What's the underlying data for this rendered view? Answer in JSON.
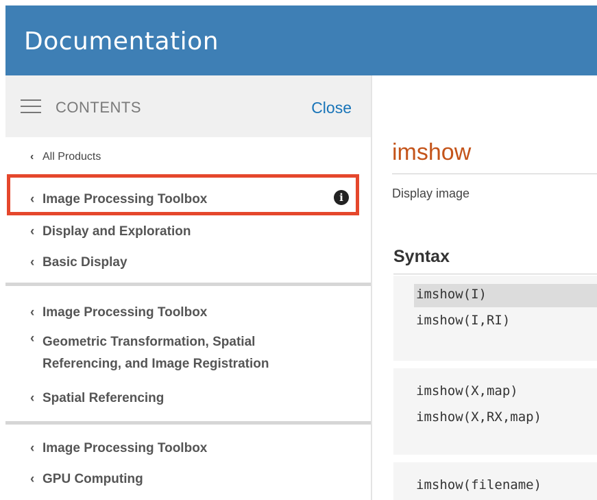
{
  "header": {
    "title": "Documentation"
  },
  "sidebar": {
    "contents_label": "CONTENTS",
    "close_label": "Close",
    "chevron": "‹",
    "all_products": "All Products",
    "info_icon_glyph": "i",
    "groups": [
      {
        "items": [
          "Image Processing Toolbox",
          "Display and Exploration",
          "Basic Display"
        ]
      },
      {
        "items": [
          "Image Processing Toolbox",
          "Geometric Transformation, Spatial",
          "Referencing, and Image Registration",
          "Spatial Referencing"
        ]
      },
      {
        "items": [
          "Image Processing Toolbox",
          "GPU Computing"
        ]
      }
    ]
  },
  "main": {
    "title": "imshow",
    "purpose": "Display image",
    "syntax_heading": "Syntax",
    "code": [
      "imshow(I)",
      "imshow(I,RI)",
      "imshow(X,map)",
      "imshow(X,RX,map)",
      "imshow(filename)"
    ]
  },
  "colors": {
    "header_bg": "#3e7fb5",
    "title_color": "#c4541a",
    "link_color": "#1874b8",
    "highlight_border": "#e5472c"
  }
}
